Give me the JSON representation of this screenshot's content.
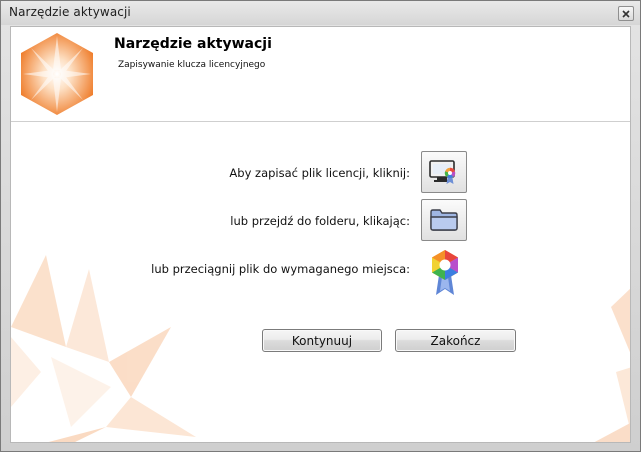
{
  "window": {
    "title": "Narzędzie aktywacji"
  },
  "header": {
    "title": "Narzędzie aktywacji",
    "subtitle": "Zapisywanie klucza licencyjnego",
    "logo_icon": "orange-hexagon-star-logo-icon"
  },
  "actions": {
    "save_prompt": "Aby zapisać plik licencji, kliknij:",
    "save_icon": "computer-with-certificate-icon",
    "folder_prompt": "lub przejdź do folderu, klikając:",
    "folder_icon": "folder-icon",
    "drag_prompt": "lub przeciągnij plik do wymaganego miejsca:",
    "drag_icon": "license-badge-icon"
  },
  "buttons": {
    "continue_label": "Kontynuuj",
    "finish_label": "Zakończ"
  },
  "colors": {
    "accent": "#f08a3c",
    "accent_light": "#fcd9bd"
  }
}
